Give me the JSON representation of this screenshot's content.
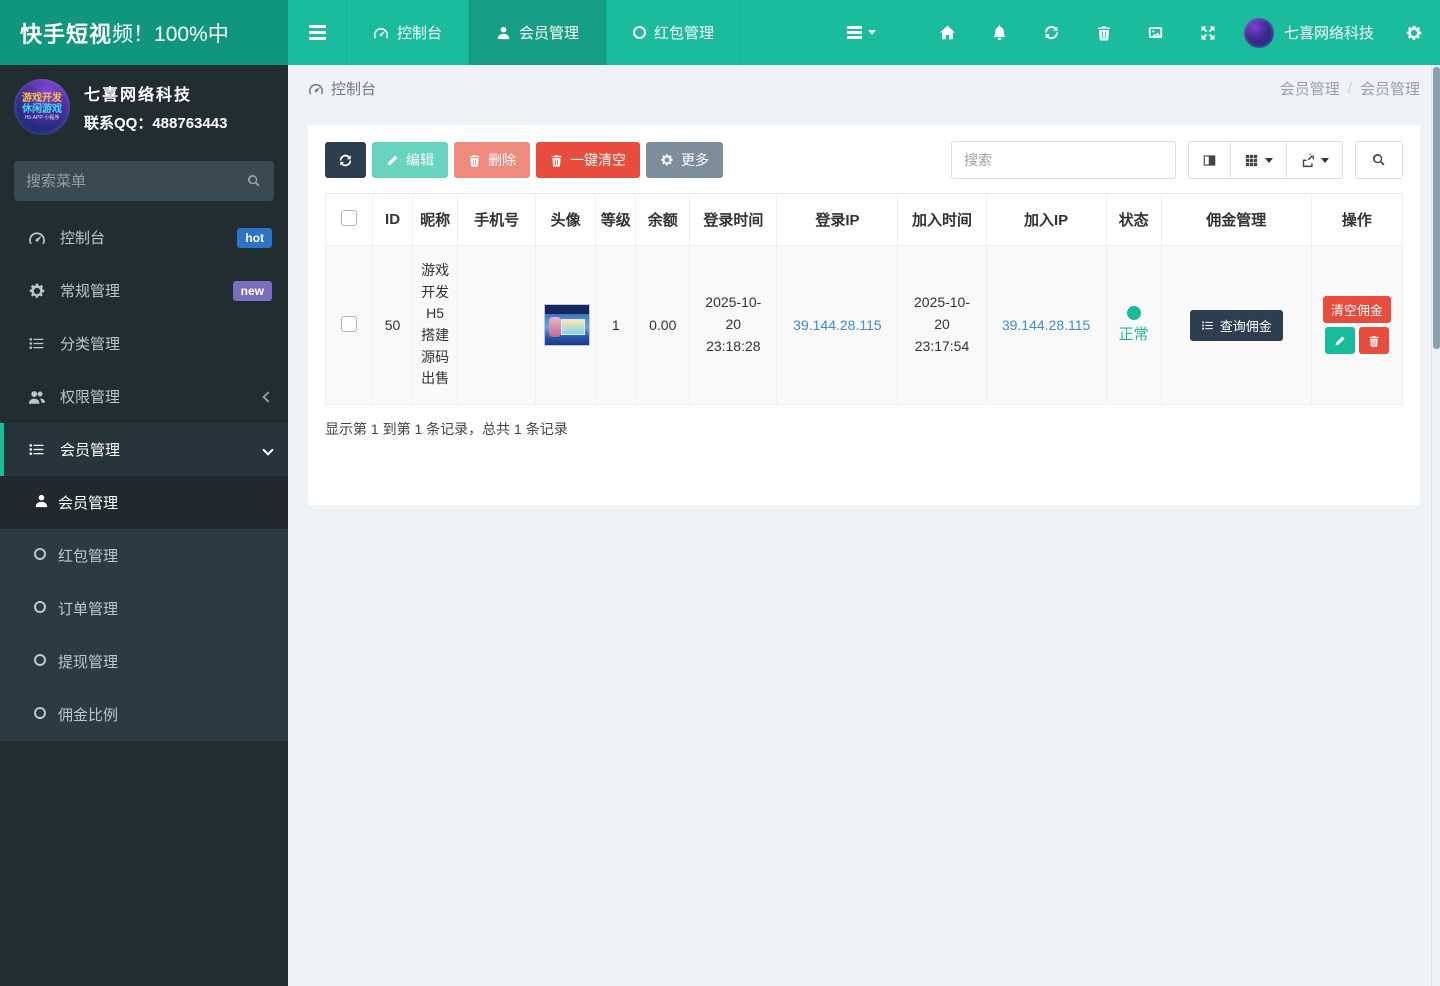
{
  "topbar": {
    "brand_bold": "快手短视",
    "brand_rest": "频！100%中",
    "tabs": [
      {
        "label": "控制台"
      },
      {
        "label": "会员管理"
      },
      {
        "label": "红包管理"
      }
    ],
    "user_name": "七喜网络科技"
  },
  "sidebar": {
    "logo_line1": "游戏开发",
    "logo_line2": "休闲游戏",
    "logo_line3": "H5·APP·小程序",
    "org_name": "七喜网络科技",
    "org_contact": "联系QQ：488763443",
    "search_placeholder": "搜索菜单",
    "menu": [
      {
        "label": "控制台",
        "badge": "hot"
      },
      {
        "label": "常规管理",
        "badge": "new"
      },
      {
        "label": "分类管理"
      },
      {
        "label": "权限管理"
      },
      {
        "label": "会员管理"
      }
    ],
    "submenu": [
      {
        "label": "会员管理"
      },
      {
        "label": "红包管理"
      },
      {
        "label": "订单管理"
      },
      {
        "label": "提现管理"
      },
      {
        "label": "佣金比例"
      }
    ]
  },
  "breadcrumb": {
    "left": "控制台",
    "parent": "会员管理",
    "sep": "/",
    "current": "会员管理"
  },
  "toolbar": {
    "edit_label": "编辑",
    "delete_label": "删除",
    "clear_label": "一键清空",
    "more_label": "更多",
    "search_placeholder": "搜索"
  },
  "table": {
    "columns": [
      "ID",
      "昵称",
      "手机号",
      "头像",
      "等级",
      "余额",
      "登录时间",
      "登录IP",
      "加入时间",
      "加入IP",
      "状态",
      "佣金管理",
      "操作"
    ],
    "row": {
      "id": "50",
      "nickname": "游戏开发H5搭建源码出售",
      "phone": "",
      "level": "1",
      "balance": "0.00",
      "login_time": "2025-10-20 23:18:28",
      "login_ip": "39.144.28.115",
      "join_time": "2025-10-20 23:17:54",
      "join_ip": "39.144.28.115",
      "status": "正常",
      "commission_label": "查询佣金",
      "op_clear_label": "清空佣金"
    },
    "footer": "显示第 1 到第 1 条记录，总共 1 条记录"
  },
  "colors": {
    "accent": "#1abc9c",
    "navbar": "#1bbc9d",
    "dark": "#2c3e50",
    "danger": "#e74c3c",
    "link": "#428bca",
    "badge_hot": "#2d74c5",
    "badge_new": "#7a6fbe"
  }
}
